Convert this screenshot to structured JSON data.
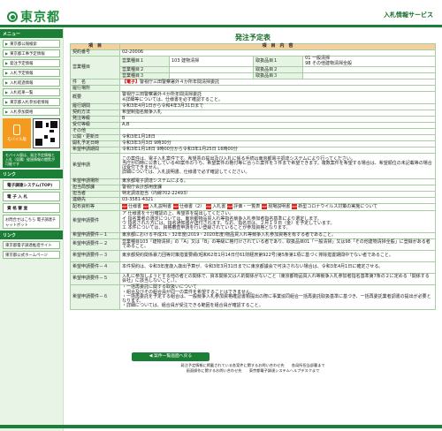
{
  "header": {
    "logo": "東京都",
    "service": "入札情報サービス"
  },
  "sidebar": {
    "section1": "メニュー",
    "items": [
      "東京都公報検索",
      "東京都工事予定情報",
      "発注予定情報",
      "入札予定情報",
      "入札経過情報",
      "入札結果一覧",
      "東京都入札参加者情報",
      "入札参加資格"
    ],
    "mobile_label": "モバイル版",
    "mobile_note": "モバイル版は、発注予定情報と入札（見積）経過情報の閲覧が可能です",
    "section2": "リンク",
    "links": [
      "電子調達システム(TOP)",
      "電 子 入 札",
      "資 格 審 査"
    ],
    "checker": "お問合せはこちら 電子調達チャットボット",
    "section3": "リンク",
    "links2": [
      "東京都電子調達推進サイト",
      "東京都公式ホームページ"
    ]
  },
  "main": {
    "title": "発注予定表",
    "head": {
      "item": "項　目",
      "content": "項　目　内　容"
    },
    "contract_no_label": "契約番号",
    "contract_no": "02-20006",
    "business_label": "営業種目",
    "business": [
      {
        "k": "営業種目１",
        "v": "103 建物清掃",
        "k2": "取扱品目１",
        "v2": "01 一般清掃\n98 その他建物清掃全般"
      },
      {
        "k": "営業種目２",
        "v": "",
        "k2": "取扱品目２",
        "v2": ""
      },
      {
        "k": "営業種目３",
        "v": "",
        "k2": "取扱品目３",
        "v2": ""
      }
    ],
    "name_label": "件　名",
    "name": "警視庁三田警察署外４か所年間清掃委託",
    "place_label": "履行場所",
    "place": "",
    "summary_label": "概要",
    "summary": "警視庁三田警察署外４か所年間清掃委託\n※詳細等については、仕様書を必ず確認すること。",
    "period_label": "履行期間",
    "period": "令和3年4月1日から令和4年3月31日まで",
    "method_label": "契約方法",
    "method": "希望制指名競争入札",
    "grade_label": "発注等級",
    "grade": "B",
    "accept_label": "受付等級",
    "accept": "A,B",
    "other_label": "その他",
    "other": "",
    "announce_label": "公開・更新日",
    "announce": "令和3年1月18日",
    "release_label": "開札予定日時",
    "release": "令和3年3月3日 9時30分",
    "apply_period_label": "希望申請期間",
    "apply_period": "令和3年1月18日 9時00分から令和3年1月25日 16時00分",
    "apply_label": "希望申請",
    "apply": "この案件は、電子入札案件です。希望票の提出及び入札に係る手続は東京都電子調達システムにより行ってください。\n当庁が同時に公表している40案件のうち、希望案件の格付等に合った案件を３件まで希望できます。複数案件を希望する場合は、希望順位の未記載等の場合は受付できません。\n詳細については、入札説明書、仕様書で必ず確認してください。",
    "apply_accept_label": "希望申請場所",
    "apply_accept": "東京都電子調達システムによる。",
    "dept_label": "担当局部課",
    "dept": "警視庁会計部用度課",
    "person_label": "担当者",
    "person": "特定調達担当（内線702-22493）",
    "tel_label": "連絡先",
    "tel": "03-3581-4321",
    "attach_label": "配布資料等",
    "attachments": [
      "仕様書",
      "入札説明書",
      "仕様書（2）",
      "入札書",
      "評価・一覧表",
      "現場説明書",
      "新型コロナウイルス対策の実施について"
    ],
    "cond_label": "希望申請要件",
    "cond": "ア 仕様書を十分確認の上、希望票を提出してください。\nイ 指名業者の選定については、東京都物品買入れ等指名競争入札参加者指名基準により選定します。\nウ 指名された方には、指名通知書が送付されます。なお、指名日は、２月１９日（金）を予定しています。\nエ 本件については、資格審査申請を行い登録されていることが参加資格となります。",
    "req": [
      {
        "k": "希望申請要件－１",
        "v": "東京都における平成31・32年度(2019・2020年度)物品買入れ等競争入札参加資格を有する者であること。"
      },
      {
        "k": "希望申請要件－２",
        "v": "営業種目103「建物清掃」の「A」又は「B」の等級に格付けされている者であり、取扱品目01「一般清掃」又は98「その他建物清掃全般」に登録がある者であること。"
      },
      {
        "k": "希望申請要件－３",
        "v": "東京都契約関係暴力団等対策措置要綱(昭和62年1月14日付61財経庶第922号)第5条第1項に基づく排除措置期間中でない者であること。"
      },
      {
        "k": "希望申請要件－４",
        "v": "本件契約は、令和3年度歳入歳出予算が、令和3年3月31日までに東京都議会で可決されない場合は、令和3年4月1日に確定させる。"
      },
      {
        "k": "希望申請要件－５",
        "v": "入札に参加しようとする他の者との関係で、資本関係又は人的関係がないこと（東京都物品買入れ等競争入札参加者指名基準第7条の２に定める「関係する会社」に該当しないこと。）。"
      },
      {
        "k": "希望申請要件－６",
        "v": "・一括再委託に関する取扱いについて\n・組合及びその組合員が同一の案件を希望することはできません。\n・一括再委託を予定する組合は、一般競争入札参加資格確認書類提出の際に事業協同組合一括再委託取扱基準に基づき、一括再委託業者調書の提出が必要となります。\n・詳細については、組合員が受注できる範囲を組合員が確認すること。"
      }
    ],
    "back_button": "案件一覧画面へ戻る"
  },
  "footer": {
    "line1": "発注予定情報に掲載されている各案件に関するお問い合わせ先　　各局所担当部署まで",
    "line2": "画面操作に関するお問い合わせ先　　東京都電子調達システムヘルプデスクまで"
  }
}
